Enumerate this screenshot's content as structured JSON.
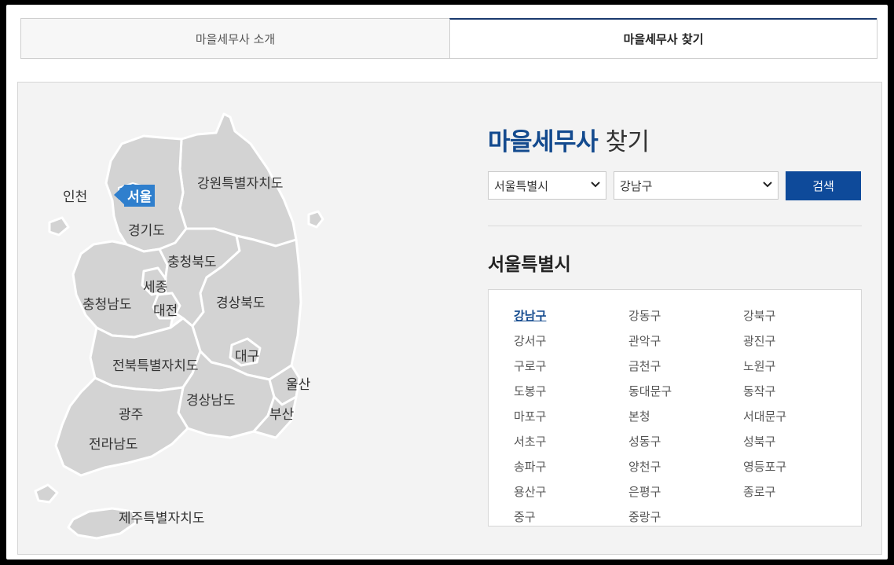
{
  "tabs": [
    {
      "label": "마을세무사 소개",
      "active": false
    },
    {
      "label": "마을세무사 찾기",
      "active": true
    }
  ],
  "map": {
    "selected": "서울",
    "labels": [
      "인천",
      "서울",
      "강원특별자치도",
      "경기도",
      "충청북도",
      "세종",
      "충청남도",
      "대전",
      "경상북도",
      "대구",
      "전북특별자치도",
      "울산",
      "경상남도",
      "광주",
      "부산",
      "전라남도",
      "제주특별자치도"
    ],
    "colors": {
      "region": "#d3d3d3",
      "selected": "#2f7fcd"
    }
  },
  "finder": {
    "title_highlight": "마을세무사",
    "title_rest": " 찾기",
    "province_select": "서울특별시",
    "district_select": "강남구",
    "search_label": "검색",
    "section_title": "서울특별시",
    "districts": [
      "강남구",
      "강동구",
      "강북구",
      "강서구",
      "관악구",
      "광진구",
      "구로구",
      "금천구",
      "노원구",
      "도봉구",
      "동대문구",
      "동작구",
      "마포구",
      "본청",
      "서대문구",
      "서초구",
      "성동구",
      "성북구",
      "송파구",
      "양천구",
      "영등포구",
      "용산구",
      "은평구",
      "종로구",
      "중구",
      "중랑구"
    ],
    "active_district": "강남구",
    "accent": "#134a8e",
    "button_color": "#0e4a9a"
  }
}
